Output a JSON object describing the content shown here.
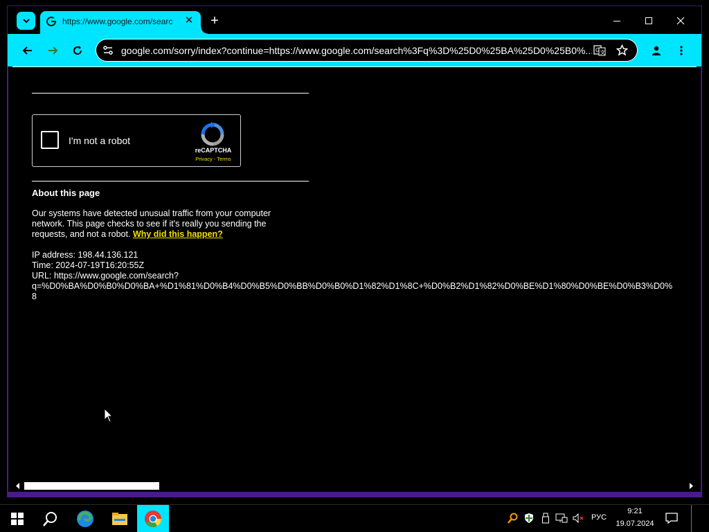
{
  "browser": {
    "tab_title": "https://www.google.com/searc",
    "tab_close": "✕",
    "new_tab": "+",
    "url": "google.com/sorry/index?continue=https://www.google.com/search%3Fq%3D%25D0%25BA%25D0%25B0%..."
  },
  "captcha": {
    "label": "I'm not a robot",
    "brand": "reCAPTCHA",
    "links": "Privacy - Terms"
  },
  "about": {
    "title": "About this page",
    "text": "Our systems have detected unusual traffic from your computer network. This page checks to see if it's really you sending the requests, and not a robot. ",
    "link": "Why did this happen?",
    "ip": "IP address: 198.44.136.121",
    "time": "Time: 2024-07-19T16:20:55Z",
    "url_label": "URL: https://www.google.com/search?",
    "url_line2": "q=%D0%BA%D0%B0%D0%BA+%D1%81%D0%B4%D0%B5%D0%BB%D0%B0%D1%82%D1%8C+%D0%B2%D1%82%D0%BE%D1%80%D0%BE%D0%B3%D0%",
    "url_line3": "8"
  },
  "taskbar": {
    "lang": "РУС",
    "time": "9:21",
    "date": "19.07.2024"
  },
  "colors": {
    "accent": "#00e5ff",
    "link": "#f0e000",
    "frame": "#4a1a8a"
  }
}
